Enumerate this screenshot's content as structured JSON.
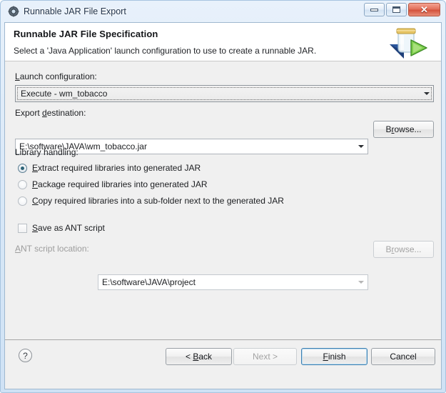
{
  "window": {
    "title": "Runnable JAR File Export",
    "icon": "jar-export-icon",
    "controls": {
      "minimize": "minimize-button",
      "maximize": "maximize-button",
      "close_glyph": "✕"
    }
  },
  "header": {
    "title": "Runnable JAR File Specification",
    "subtitle": "Select a 'Java Application' launch configuration to use to create a runnable JAR.",
    "icon": "jar-with-green-arrow-icon"
  },
  "form": {
    "launch_configuration": {
      "label": "Launch configuration:",
      "value": "Execute - wm_tobacco",
      "focused": true
    },
    "export_destination": {
      "label": "Export destination:",
      "value": "E:\\software\\JAVA\\wm_tobacco.jar",
      "browse_label": "Browse..."
    },
    "library_handling": {
      "label": "Library handling:",
      "options": [
        {
          "label": "Extract required libraries into generated JAR",
          "selected": true
        },
        {
          "label": "Package required libraries into generated JAR",
          "selected": false
        },
        {
          "label": "Copy required libraries into a sub-folder next to the generated JAR",
          "selected": false
        }
      ]
    },
    "ant_script": {
      "checkbox_label": "Save as ANT script",
      "checked": false,
      "location_label": "ANT script location:",
      "location_value": "E:\\software\\JAVA\\project",
      "browse_label": "Browse...",
      "enabled": false
    }
  },
  "footer": {
    "help_glyph": "?",
    "buttons": [
      {
        "label": "< Back",
        "state": "enabled"
      },
      {
        "label": "Next >",
        "state": "disabled"
      },
      {
        "label": "Finish",
        "state": "default"
      },
      {
        "label": "Cancel",
        "state": "enabled"
      }
    ]
  },
  "colors": {
    "frame": "#cfe2f5",
    "body": "#f0f0f0",
    "header_band": "#ffffff",
    "default_button_border": "#3c7fb1",
    "radio_dot": "#2d6377",
    "close_button": "#d4523c"
  }
}
